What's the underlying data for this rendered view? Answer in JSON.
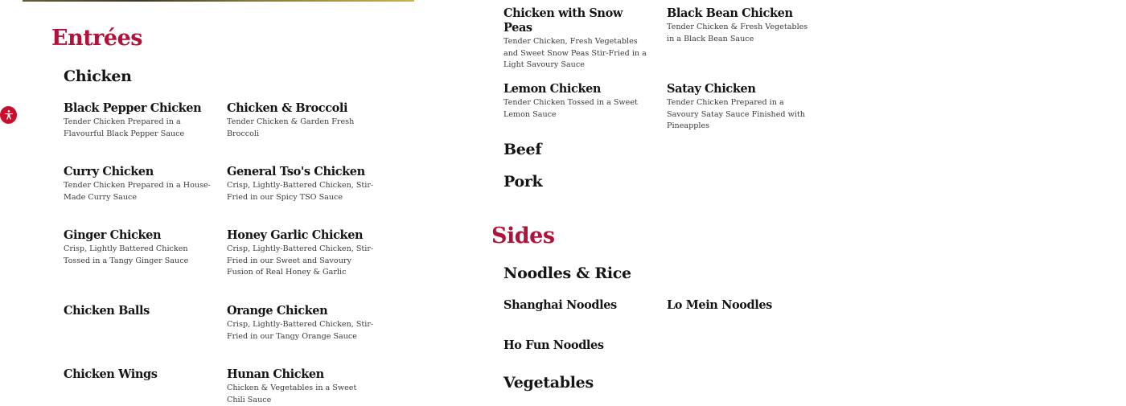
{
  "brand": {
    "accent": "#b0123a",
    "accessibility_color": "#c8102e"
  },
  "accessibility": {
    "icon": "accessibility-icon"
  },
  "entrees": {
    "title": "Entrées",
    "chicken": {
      "title": "Chicken",
      "items": [
        {
          "name": "Black Pepper Chicken",
          "desc": "Tender Chicken Prepared in a Flavourful Black Pepper Sauce"
        },
        {
          "name": "Chicken & Broccoli",
          "desc": "Tender Chicken & Garden Fresh Broccoli"
        },
        {
          "name": "Curry Chicken",
          "desc": "Tender Chicken Prepared in a House-Made Curry Sauce"
        },
        {
          "name": "General Tso's Chicken",
          "desc": "Crisp, Lightly-Battered Chicken, Stir-Fried in our Spicy TSO Sauce"
        },
        {
          "name": "Ginger Chicken",
          "desc": "Crisp, Lightly Battered Chicken Tossed in a Tangy Ginger Sauce"
        },
        {
          "name": "Honey Garlic Chicken",
          "desc": "Crisp, Lightly-Battered Chicken, Stir-Fried in our Sweet and Savoury Fusion of Real Honey & Garlic"
        },
        {
          "name": "Chicken Balls",
          "desc": ""
        },
        {
          "name": "Orange Chicken",
          "desc": "Crisp, Lightly-Battered Chicken, Stir-Fried in our Tangy Orange Sauce"
        },
        {
          "name": "Chicken Wings",
          "desc": ""
        },
        {
          "name": "Hunan Chicken",
          "desc": "Chicken & Vegetables in a Sweet Chili Sauce"
        },
        {
          "name": "Chicken with Snow Peas",
          "desc": "Tender Chicken, Fresh Vegetables and Sweet Snow Peas Stir-Fried in a Light Savoury Sauce"
        },
        {
          "name": "Black Bean Chicken",
          "desc": "Tender Chicken & Fresh Vegetables in a Black Bean Sauce"
        },
        {
          "name": "Lemon Chicken",
          "desc": "Tender Chicken Tossed in a Sweet Lemon Sauce"
        },
        {
          "name": "Satay Chicken",
          "desc": "Tender Chicken Prepared in a Savoury Satay Sauce Finished with Pineapples"
        }
      ]
    },
    "beef": {
      "title": "Beef"
    },
    "pork": {
      "title": "Pork"
    }
  },
  "sides": {
    "title": "Sides",
    "noodles": {
      "title": "Noodles & Rice",
      "items": [
        {
          "name": "Shanghai Noodles"
        },
        {
          "name": "Lo Mein Noodles"
        },
        {
          "name": "Ho Fun Noodles"
        }
      ]
    },
    "vegetables": {
      "title": "Vegetables"
    }
  }
}
